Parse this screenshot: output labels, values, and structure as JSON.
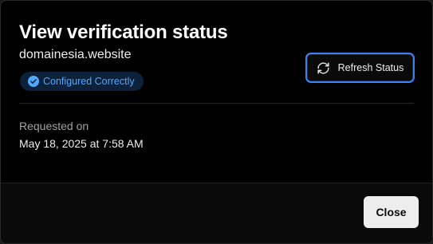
{
  "dialog": {
    "title": "View verification status",
    "domain": "domainesia.website"
  },
  "status_badge": {
    "label": "Configured Correctly",
    "icon": "check-circle-icon",
    "text_color": "#52a8ff",
    "background": "#0c213b"
  },
  "refresh_button": {
    "label": "Refresh Status",
    "icon": "refresh-icon",
    "focus_ring_color": "#3b82f6"
  },
  "requested": {
    "label": "Requested on",
    "value": "May 18, 2025 at 7:58 AM"
  },
  "footer": {
    "close_label": "Close"
  }
}
